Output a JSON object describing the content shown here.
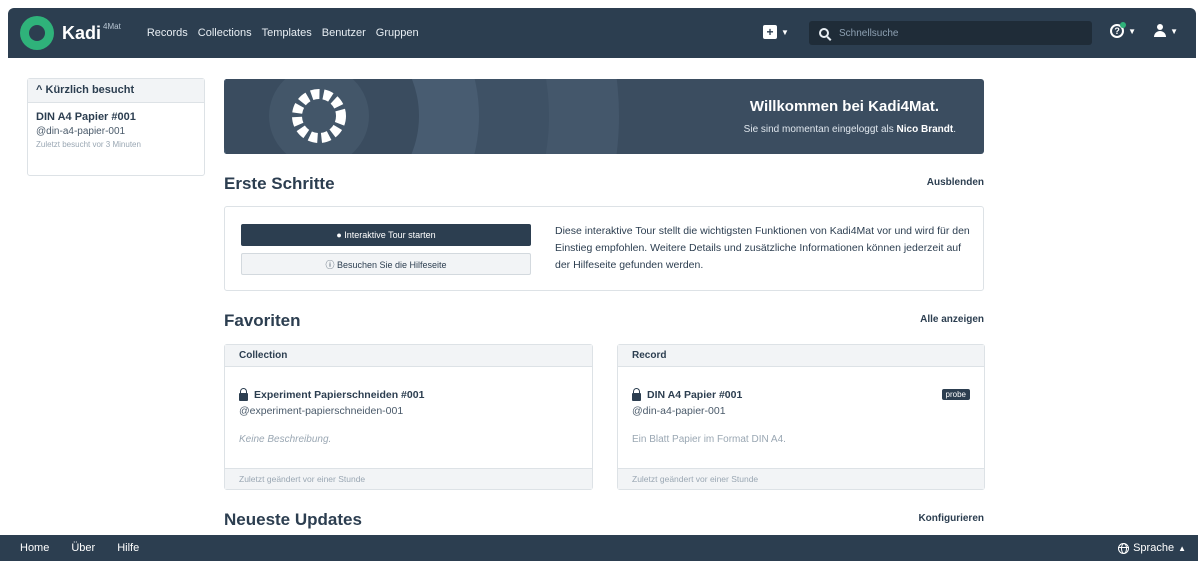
{
  "brand": {
    "name": "Kadi",
    "sup": "4Mat"
  },
  "nav": [
    "Records",
    "Collections",
    "Templates",
    "Benutzer",
    "Gruppen"
  ],
  "search": {
    "placeholder": "Schnellsuche"
  },
  "sidebar": {
    "header": "Kürzlich besucht",
    "item": {
      "title": "DIN A4 Papier #001",
      "id": "@din-a4-papier-001",
      "time": "Zuletzt besucht vor 3 Minuten"
    }
  },
  "banner": {
    "title": "Willkommen bei Kadi4Mat.",
    "sub_prefix": "Sie sind momentan eingeloggt als",
    "user": "Nico Brandt",
    "sub_suffix": "."
  },
  "first_steps": {
    "title": "Erste Schritte",
    "hide": "Ausblenden",
    "tour_button": "Interaktive Tour starten",
    "help_button": "Besuchen Sie die Hilfeseite",
    "text": "Diese interaktive Tour stellt die wichtigsten Funktionen von Kadi4Mat vor und wird für den Einstieg empfohlen. Weitere Details und zusätzliche Informationen können jederzeit auf der Hilfeseite gefunden werden."
  },
  "favorites": {
    "title": "Favoriten",
    "show_all": "Alle anzeigen",
    "cards": [
      {
        "header": "Collection",
        "title": "Experiment Papierschneiden #001",
        "id": "@experiment-papierschneiden-001",
        "desc": "Keine Beschreibung.",
        "footer": "Zuletzt geändert vor einer Stunde"
      },
      {
        "header": "Record",
        "title": "DIN A4 Papier #001",
        "id": "@din-a4-papier-001",
        "desc": "Ein Blatt Papier im Format DIN A4.",
        "badge": "probe",
        "footer": "Zuletzt geändert vor einer Stunde"
      }
    ]
  },
  "updates": {
    "title": "Neueste Updates",
    "configure": "Konfigurieren"
  },
  "footer": {
    "links": [
      "Home",
      "Über",
      "Hilfe"
    ],
    "language": "Sprache"
  },
  "colors": {
    "primary": "#2c3e50",
    "banner": "#3b4d60",
    "accent": "#2fb27a"
  }
}
